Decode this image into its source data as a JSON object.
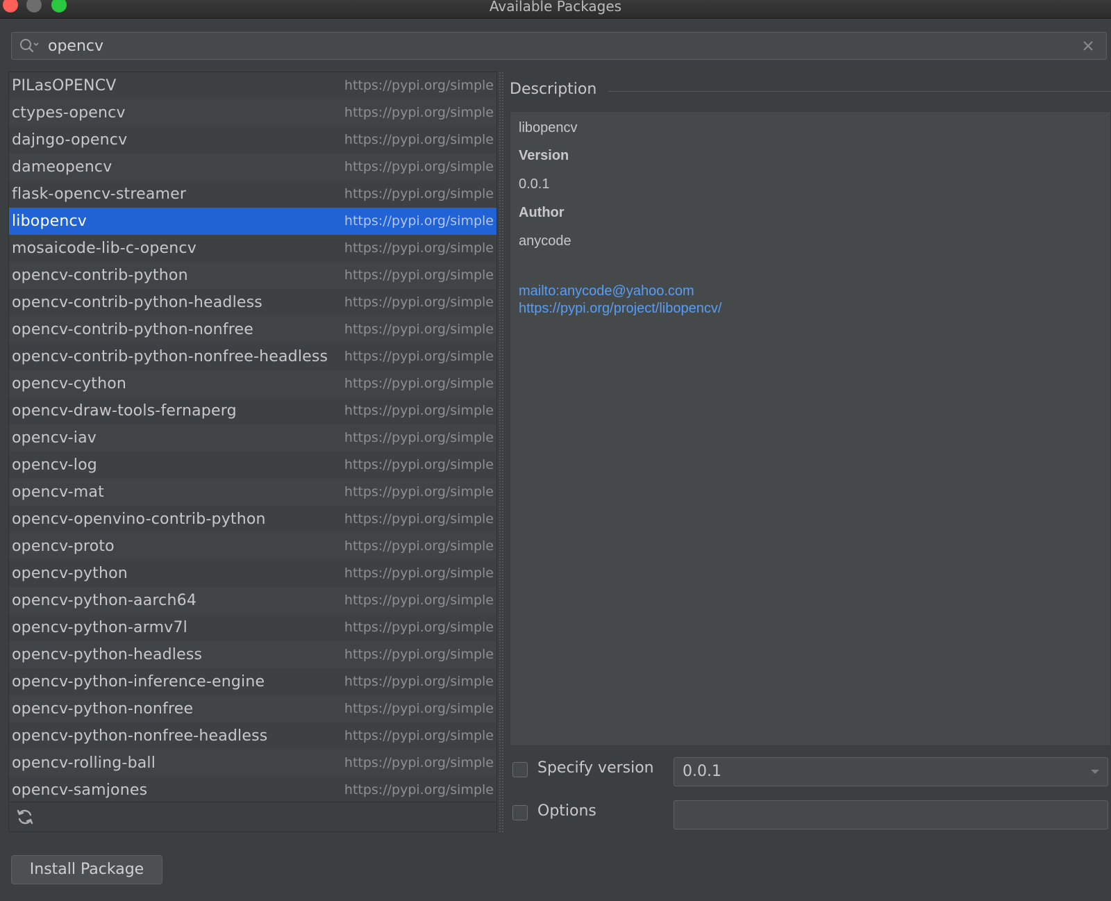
{
  "window": {
    "title": "Available Packages"
  },
  "search": {
    "value": "opencv",
    "icon": "search-icon",
    "clear_icon": "close-icon"
  },
  "packages": [
    {
      "name": "PILasOPENCV",
      "repo": "https://pypi.org/simple"
    },
    {
      "name": "ctypes-opencv",
      "repo": "https://pypi.org/simple"
    },
    {
      "name": "dajngo-opencv",
      "repo": "https://pypi.org/simple"
    },
    {
      "name": "dameopencv",
      "repo": "https://pypi.org/simple"
    },
    {
      "name": "flask-opencv-streamer",
      "repo": "https://pypi.org/simple"
    },
    {
      "name": "libopencv",
      "repo": "https://pypi.org/simple"
    },
    {
      "name": "mosaicode-lib-c-opencv",
      "repo": "https://pypi.org/simple"
    },
    {
      "name": "opencv-contrib-python",
      "repo": "https://pypi.org/simple"
    },
    {
      "name": "opencv-contrib-python-headless",
      "repo": "https://pypi.org/simple"
    },
    {
      "name": "opencv-contrib-python-nonfree",
      "repo": "https://pypi.org/simple"
    },
    {
      "name": "opencv-contrib-python-nonfree-headless",
      "repo": "https://pypi.org/simple"
    },
    {
      "name": "opencv-cython",
      "repo": "https://pypi.org/simple"
    },
    {
      "name": "opencv-draw-tools-fernaperg",
      "repo": "https://pypi.org/simple"
    },
    {
      "name": "opencv-iav",
      "repo": "https://pypi.org/simple"
    },
    {
      "name": "opencv-log",
      "repo": "https://pypi.org/simple"
    },
    {
      "name": "opencv-mat",
      "repo": "https://pypi.org/simple"
    },
    {
      "name": "opencv-openvino-contrib-python",
      "repo": "https://pypi.org/simple"
    },
    {
      "name": "opencv-proto",
      "repo": "https://pypi.org/simple"
    },
    {
      "name": "opencv-python",
      "repo": "https://pypi.org/simple"
    },
    {
      "name": "opencv-python-aarch64",
      "repo": "https://pypi.org/simple"
    },
    {
      "name": "opencv-python-armv7l",
      "repo": "https://pypi.org/simple"
    },
    {
      "name": "opencv-python-headless",
      "repo": "https://pypi.org/simple"
    },
    {
      "name": "opencv-python-inference-engine",
      "repo": "https://pypi.org/simple"
    },
    {
      "name": "opencv-python-nonfree",
      "repo": "https://pypi.org/simple"
    },
    {
      "name": "opencv-python-nonfree-headless",
      "repo": "https://pypi.org/simple"
    },
    {
      "name": "opencv-rolling-ball",
      "repo": "https://pypi.org/simple"
    },
    {
      "name": "opencv-samjones",
      "repo": "https://pypi.org/simple"
    }
  ],
  "selected_package": "libopencv",
  "list_footer": {
    "refresh_icon": "refresh-icon"
  },
  "description": {
    "title": "Description",
    "package_name": "libopencv",
    "version_label": "Version",
    "version_value": "0.0.1",
    "author_label": "Author",
    "author_value": "anycode",
    "links": [
      "mailto:anycode@yahoo.com",
      "https://pypi.org/project/libopencv/"
    ]
  },
  "options": {
    "specify_version_label": "Specify version",
    "specify_version_checked": false,
    "version_selected": "0.0.1",
    "options_label": "Options",
    "options_checked": false,
    "options_value": ""
  },
  "install_button": {
    "label": "Install Package"
  },
  "colors": {
    "background": "#3c3f41",
    "selection": "#2162d4",
    "link": "#589df6",
    "close_button": "#fe5f57",
    "maximize_button": "#2ac840"
  }
}
